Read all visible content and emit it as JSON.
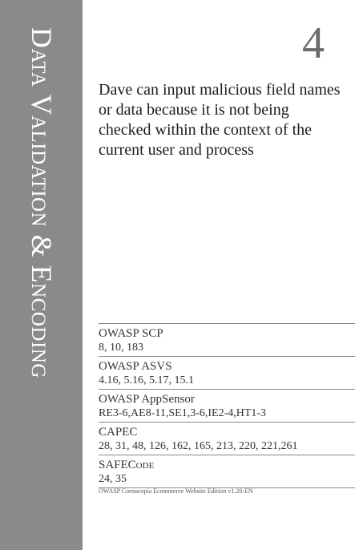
{
  "card": {
    "category": "Data Validation & Encoding",
    "number": "4",
    "description": "Dave can input malicious field names or data because it is not being checked within the context of the current user and process",
    "references": [
      {
        "name": "OWASP SCP",
        "values": "8, 10, 183"
      },
      {
        "name": "OWASP ASVS",
        "values": "4.16, 5.16, 5.17, 15.1"
      },
      {
        "name": "OWASP AppSensor",
        "values": "RE3-6,AE8-11,SE1,3-6,IE2-4,HT1-3"
      },
      {
        "name": "CAPEC",
        "values": "28, 31, 48, 126, 162, 165, 213, 220, 221,261"
      },
      {
        "name": "SAFECode",
        "values": "24, 35"
      }
    ],
    "footer": "OWASP Cornucopia Ecommerce Website Edition v1.20-EN"
  },
  "colors": {
    "side_band": "#8a8a8a",
    "side_text": "#ffffff",
    "number": "#6b6b6b",
    "rule": "#888888"
  }
}
